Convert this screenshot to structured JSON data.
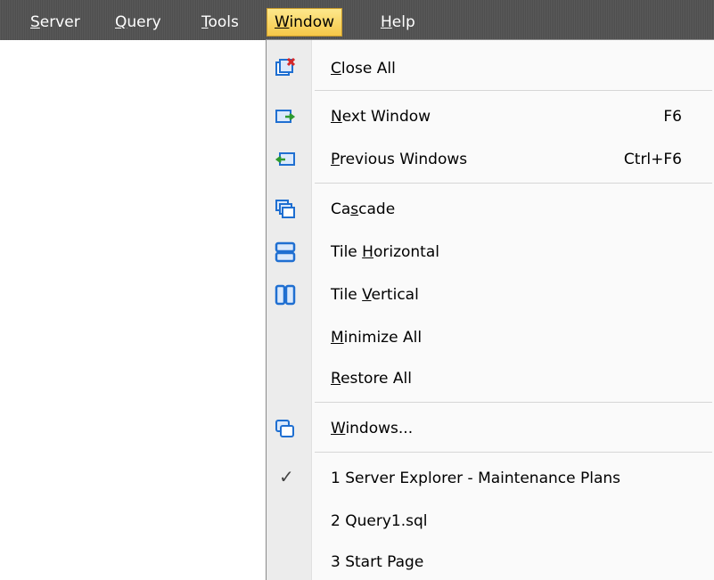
{
  "menubar": {
    "server": {
      "pre": "",
      "key": "S",
      "post": "erver"
    },
    "query": {
      "pre": "",
      "key": "Q",
      "post": "uery"
    },
    "tools": {
      "pre": "",
      "key": "T",
      "post": "ools"
    },
    "window": {
      "pre": "",
      "key": "W",
      "post": "indow"
    },
    "help": {
      "pre": "",
      "key": "H",
      "post": "elp"
    }
  },
  "window_menu": {
    "close_all": {
      "pre": "",
      "key": "C",
      "post": "lose All",
      "icon": "close-all-icon"
    },
    "next_window": {
      "pre": "",
      "key": "N",
      "post": "ext Window",
      "shortcut": "F6",
      "icon": "next-window-icon"
    },
    "previous_windows": {
      "pre": "",
      "key": "P",
      "post": "revious Windows",
      "shortcut": "Ctrl+F6",
      "icon": "previous-window-icon"
    },
    "cascade": {
      "pre": "Ca",
      "key": "s",
      "post": "cade",
      "icon": "cascade-icon"
    },
    "tile_horizontal": {
      "pre": "Tile ",
      "key": "H",
      "post": "orizontal",
      "icon": "tile-horizontal-icon"
    },
    "tile_vertical": {
      "pre": "Tile ",
      "key": "V",
      "post": "ertical",
      "icon": "tile-vertical-icon"
    },
    "minimize_all": {
      "pre": "",
      "key": "M",
      "post": "inimize All"
    },
    "restore_all": {
      "pre": "",
      "key": "R",
      "post": "estore All"
    },
    "windows": {
      "pre": "",
      "key": "W",
      "post": "indows...",
      "icon": "windows-icon"
    },
    "open_windows": [
      {
        "label": "1 Server Explorer - Maintenance Plans",
        "checked": true
      },
      {
        "label": "2 Query1.sql",
        "checked": false
      },
      {
        "label": "3 Start Page",
        "checked": false
      }
    ]
  },
  "colors": {
    "menubar_bg": "#555555",
    "active_menu_bg": "#f8d466",
    "icon_blue": "#1f6fd1",
    "icon_green": "#2e9a2e",
    "icon_red": "#d62828"
  }
}
